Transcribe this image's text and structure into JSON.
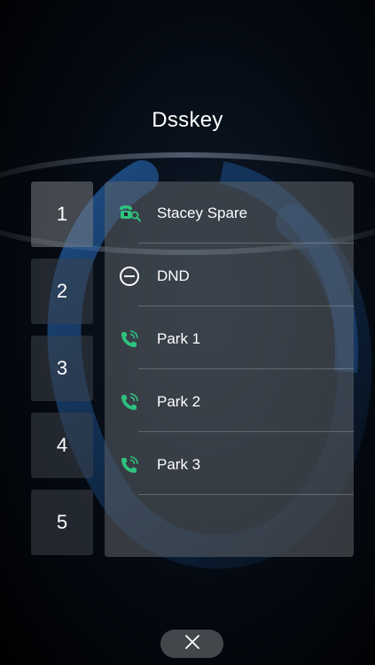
{
  "title": "Dsskey",
  "tabs": [
    {
      "label": "1",
      "active": true
    },
    {
      "label": "2",
      "active": false
    },
    {
      "label": "3",
      "active": false
    },
    {
      "label": "4",
      "active": false
    },
    {
      "label": "5",
      "active": false
    }
  ],
  "keys": [
    {
      "label": "Stacey Spare",
      "icon": "blf-phone-icon"
    },
    {
      "label": "DND",
      "icon": "dnd-icon"
    },
    {
      "label": "Park 1",
      "icon": "call-park-icon"
    },
    {
      "label": "Park 2",
      "icon": "call-park-icon"
    },
    {
      "label": "Park 3",
      "icon": "call-park-icon"
    }
  ],
  "close": {
    "icon": "close-icon"
  },
  "colors": {
    "accent_green": "#2ec27e",
    "text": "#ffffff"
  }
}
